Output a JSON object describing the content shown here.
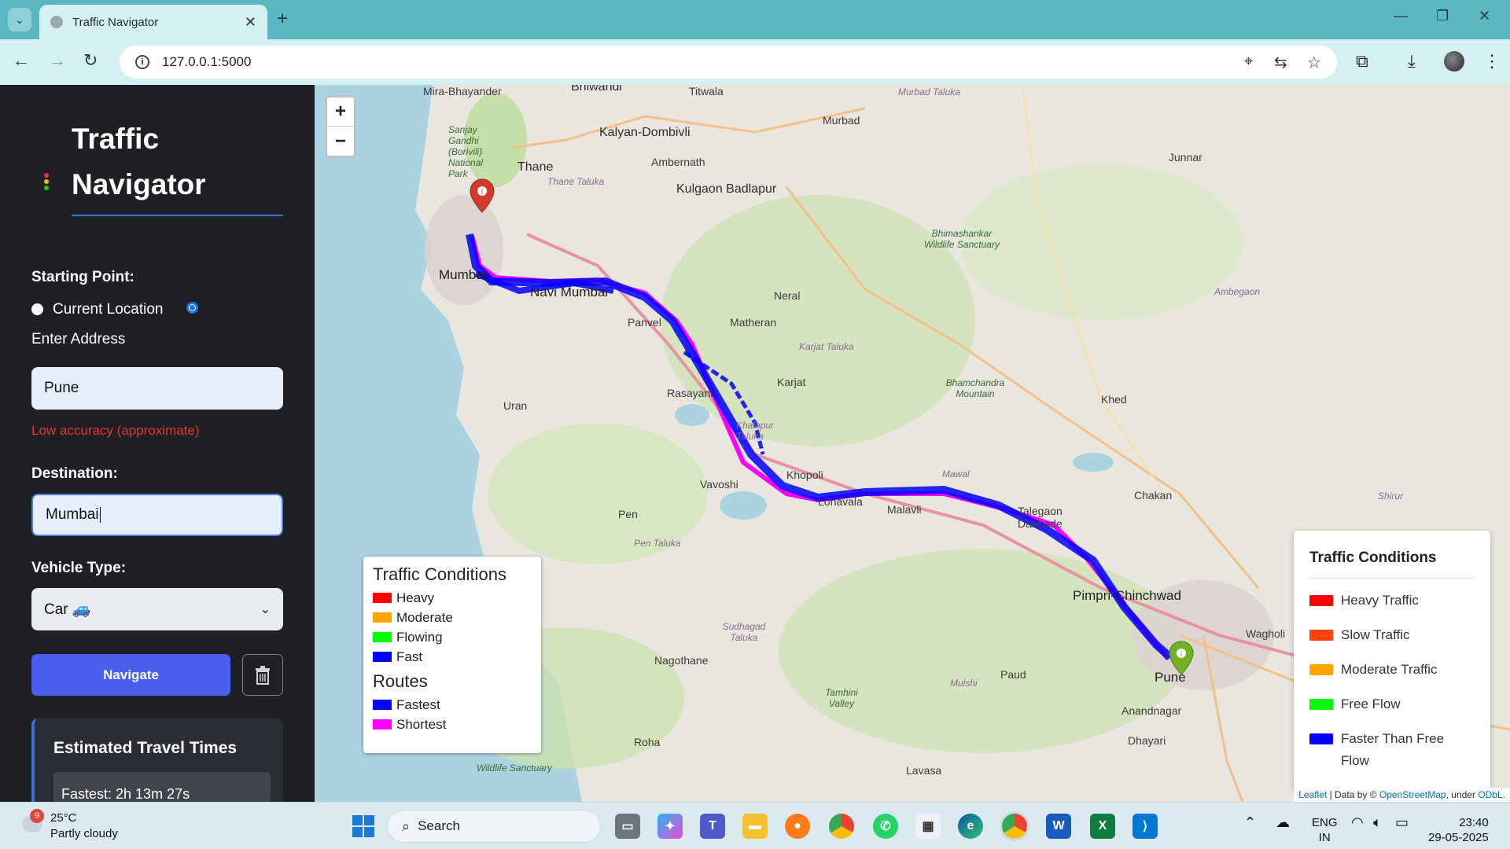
{
  "browser": {
    "tab_title": "Traffic Navigator",
    "url": "127.0.0.1:5000"
  },
  "sidebar": {
    "title_line1": "Traffic",
    "title_line2": "Navigator",
    "starting_point_label": "Starting Point:",
    "current_location_label": "Current Location",
    "enter_address_label": "Enter Address",
    "start_value": "Pune",
    "accuracy_warning": "Low accuracy (approximate)",
    "destination_label": "Destination:",
    "destination_value": "Mumbai",
    "vehicle_label": "Vehicle Type:",
    "vehicle_value": "Car 🚙",
    "navigate_label": "Navigate",
    "estimates_title": "Estimated Travel Times",
    "fastest_time": "Fastest: 2h 13m 27s"
  },
  "map": {
    "zoom_in": "+",
    "zoom_out": "−",
    "places": {
      "mira": "Mira-Bhayander",
      "bhiwandi": "Bhiwandi",
      "titwala": "Titwala",
      "murbad_taluka": "Murbad Taluka",
      "kalyan": "Kalyan-Dombivli",
      "murbad": "Murbad",
      "junnar": "Junnar",
      "sanjay": "Sanjay Gandhi (Borivili) National Park",
      "thane": "Thane",
      "thane_taluka": "Thane Taluka",
      "ambernath": "Ambernath",
      "kulgaon": "Kulgaon Badlapur",
      "bhimashankar": "Bhimashankar Wildlife Sanctuary",
      "mumbai": "Mumbai",
      "navi_mumbai": "Navi Mumbai",
      "neral": "Neral",
      "ambegaon": "Ambegaon",
      "matheran": "Matheran",
      "panvel": "Panvel",
      "karjat_taluka": "Karjat Taluka",
      "karjat": "Karjat",
      "rasayani": "Rasayani",
      "bhamchandra": "Bhamchandra Mountain",
      "uran": "Uran",
      "khed": "Khed",
      "khalapur": "Khalapur Taluka",
      "khopoli": "Khopoli",
      "vavoshi": "Vavoshi",
      "mawal": "Mawal",
      "chakan": "Chakan",
      "shirur": "Shirur",
      "lonavala": "Lonavala",
      "malavli": "Malavli",
      "talegaon": "Talegaon Dabhade",
      "pen": "Pen",
      "pen_taluka": "Pen Taluka",
      "pimpri": "Pimpri-Chinchwad",
      "sudhagad": "Sudhagad Taluka",
      "wagholi": "Wagholi",
      "nagothane": "Nagothane",
      "paud": "Paud",
      "mulshi": "Mulshi",
      "pune": "Pune",
      "anandnagar": "Anandnagar",
      "tamhini": "Tamhini Valley",
      "roha": "Roha",
      "dhayari": "Dhayari",
      "wildlife": "Wildlife Sanctuary",
      "lavasa": "Lavasa"
    }
  },
  "legend_small": {
    "title": "Traffic Conditions",
    "items": [
      {
        "label": "Heavy",
        "color": "#ff0000"
      },
      {
        "label": "Moderate",
        "color": "#ffa500"
      },
      {
        "label": "Flowing",
        "color": "#00ff00"
      },
      {
        "label": "Fast",
        "color": "#0000ff"
      }
    ],
    "routes_title": "Routes",
    "routes": [
      {
        "label": "Fastest",
        "color": "#0000ff"
      },
      {
        "label": "Shortest",
        "color": "#ff00ff"
      }
    ]
  },
  "legend_large": {
    "title": "Traffic Conditions",
    "items": [
      {
        "label": "Heavy Traffic",
        "color": "#ff0000"
      },
      {
        "label": "Slow Traffic",
        "color": "#ff4500"
      },
      {
        "label": "Moderate Traffic",
        "color": "#ffa500"
      },
      {
        "label": "Free Flow",
        "color": "#00ff00"
      },
      {
        "label": "Faster Than Free Flow",
        "color": "#0000ff"
      }
    ]
  },
  "attribution": {
    "leaflet": "Leaflet",
    "sep1": " | Data by © ",
    "osm": "OpenStreetMap",
    "sep2": ", under ",
    "odbl": "ODbL."
  },
  "taskbar": {
    "weather_badge": "9",
    "temperature": "25°C",
    "weather": "Partly cloudy",
    "search_label": "Search",
    "lang_line1": "ENG",
    "lang_line2": "IN",
    "time": "23:40",
    "date": "29-05-2025"
  }
}
